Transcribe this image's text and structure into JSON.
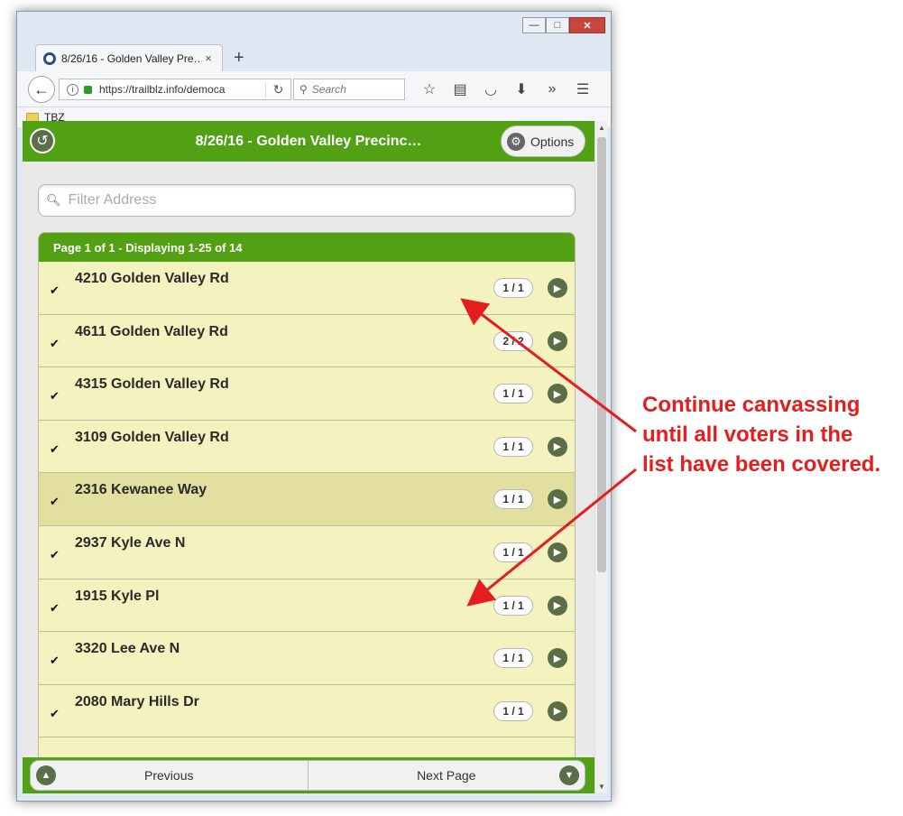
{
  "browser": {
    "tab_title": "8/26/16 - Golden Valley Pre…",
    "tab_close": "×",
    "new_tab": "+",
    "url": "https://trailblz.info/democa",
    "search_placeholder": "Search",
    "bookmark_folder": "TBZ"
  },
  "app": {
    "title": "8/26/16 - Golden Valley Precinc…",
    "options_label": "Options",
    "filter_placeholder": "Filter Address",
    "list_header": "Page 1 of 1 - Displaying 1-25 of 14",
    "rows": [
      {
        "address": "4210 Golden Valley Rd",
        "count": "1 / 1"
      },
      {
        "address": "4611 Golden Valley Rd",
        "count": "2 / 2"
      },
      {
        "address": "4315 Golden Valley Rd",
        "count": "1 / 1"
      },
      {
        "address": "3109 Golden Valley Rd",
        "count": "1 / 1"
      },
      {
        "address": "2316 Kewanee Way",
        "count": "1 / 1"
      },
      {
        "address": "2937 Kyle Ave N",
        "count": "1 / 1"
      },
      {
        "address": "1915 Kyle Pl",
        "count": "1 / 1"
      },
      {
        "address": "3320 Lee Ave N",
        "count": "1 / 1"
      },
      {
        "address": "2080 Mary Hills Dr",
        "count": "1 / 1"
      }
    ],
    "prev_label": "Previous",
    "next_label": "Next Page"
  },
  "annotation": {
    "line1": "Continue canvassing",
    "line2": "until all voters in the",
    "line3": "list have been covered."
  },
  "colors": {
    "header_green": "#52a013",
    "row_yellow": "#f4f2be",
    "annotation_red": "#e41e1e"
  }
}
